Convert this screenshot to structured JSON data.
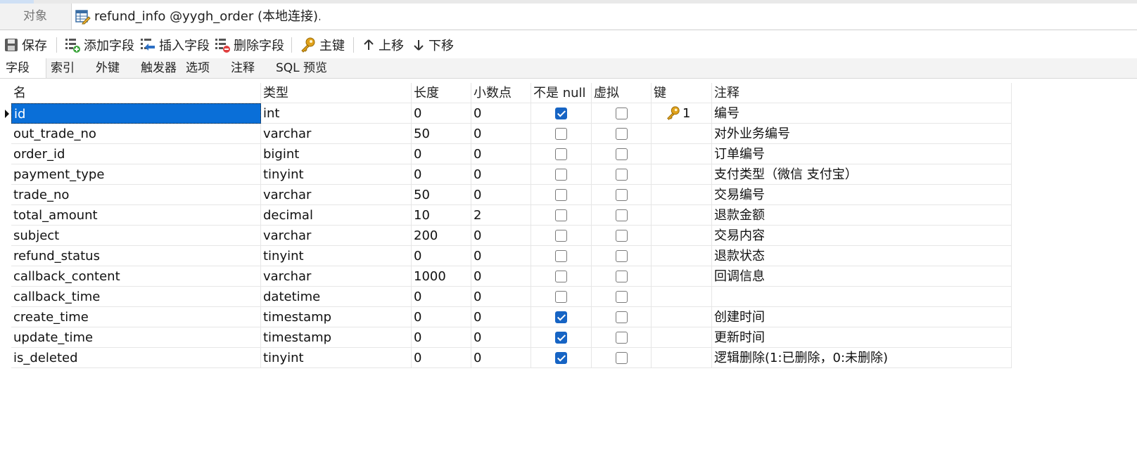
{
  "tabs": {
    "objects": "对象",
    "active": "refund_info @yygh_order (本地连接)..."
  },
  "toolbar": {
    "save": "保存",
    "add_field": "添加字段",
    "insert_field": "插入字段",
    "delete_field": "删除字段",
    "primary_key": "主键",
    "move_up": "上移",
    "move_down": "下移"
  },
  "subtabs": [
    "字段",
    "索引",
    "外键",
    "触发器",
    "选项",
    "注释",
    "SQL 预览"
  ],
  "columns": [
    "名",
    "类型",
    "长度",
    "小数点",
    "不是 null",
    "虚拟",
    "键",
    "注释"
  ],
  "rows": [
    {
      "name": "id",
      "type": "int",
      "length": "0",
      "decimals": "0",
      "not_null": true,
      "virtual": false,
      "key": "1",
      "comment": "编号"
    },
    {
      "name": "out_trade_no",
      "type": "varchar",
      "length": "50",
      "decimals": "0",
      "not_null": false,
      "virtual": false,
      "key": "",
      "comment": "对外业务编号"
    },
    {
      "name": "order_id",
      "type": "bigint",
      "length": "0",
      "decimals": "0",
      "not_null": false,
      "virtual": false,
      "key": "",
      "comment": "订单编号"
    },
    {
      "name": "payment_type",
      "type": "tinyint",
      "length": "0",
      "decimals": "0",
      "not_null": false,
      "virtual": false,
      "key": "",
      "comment": "支付类型（微信 支付宝）"
    },
    {
      "name": "trade_no",
      "type": "varchar",
      "length": "50",
      "decimals": "0",
      "not_null": false,
      "virtual": false,
      "key": "",
      "comment": "交易编号"
    },
    {
      "name": "total_amount",
      "type": "decimal",
      "length": "10",
      "decimals": "2",
      "not_null": false,
      "virtual": false,
      "key": "",
      "comment": "退款金额"
    },
    {
      "name": "subject",
      "type": "varchar",
      "length": "200",
      "decimals": "0",
      "not_null": false,
      "virtual": false,
      "key": "",
      "comment": "交易内容"
    },
    {
      "name": "refund_status",
      "type": "tinyint",
      "length": "0",
      "decimals": "0",
      "not_null": false,
      "virtual": false,
      "key": "",
      "comment": "退款状态"
    },
    {
      "name": "callback_content",
      "type": "varchar",
      "length": "1000",
      "decimals": "0",
      "not_null": false,
      "virtual": false,
      "key": "",
      "comment": "回调信息"
    },
    {
      "name": "callback_time",
      "type": "datetime",
      "length": "0",
      "decimals": "0",
      "not_null": false,
      "virtual": false,
      "key": "",
      "comment": ""
    },
    {
      "name": "create_time",
      "type": "timestamp",
      "length": "0",
      "decimals": "0",
      "not_null": true,
      "virtual": false,
      "key": "",
      "comment": "创建时间"
    },
    {
      "name": "update_time",
      "type": "timestamp",
      "length": "0",
      "decimals": "0",
      "not_null": true,
      "virtual": false,
      "key": "",
      "comment": "更新时间"
    },
    {
      "name": "is_deleted",
      "type": "tinyint",
      "length": "0",
      "decimals": "0",
      "not_null": true,
      "virtual": false,
      "key": "",
      "comment": "逻辑删除(1:已删除，0:未删除)"
    }
  ],
  "colors": {
    "selection": "#0a6fd8",
    "checkbox_checked": "#1664c4",
    "key_icon": "#e0a21b"
  }
}
